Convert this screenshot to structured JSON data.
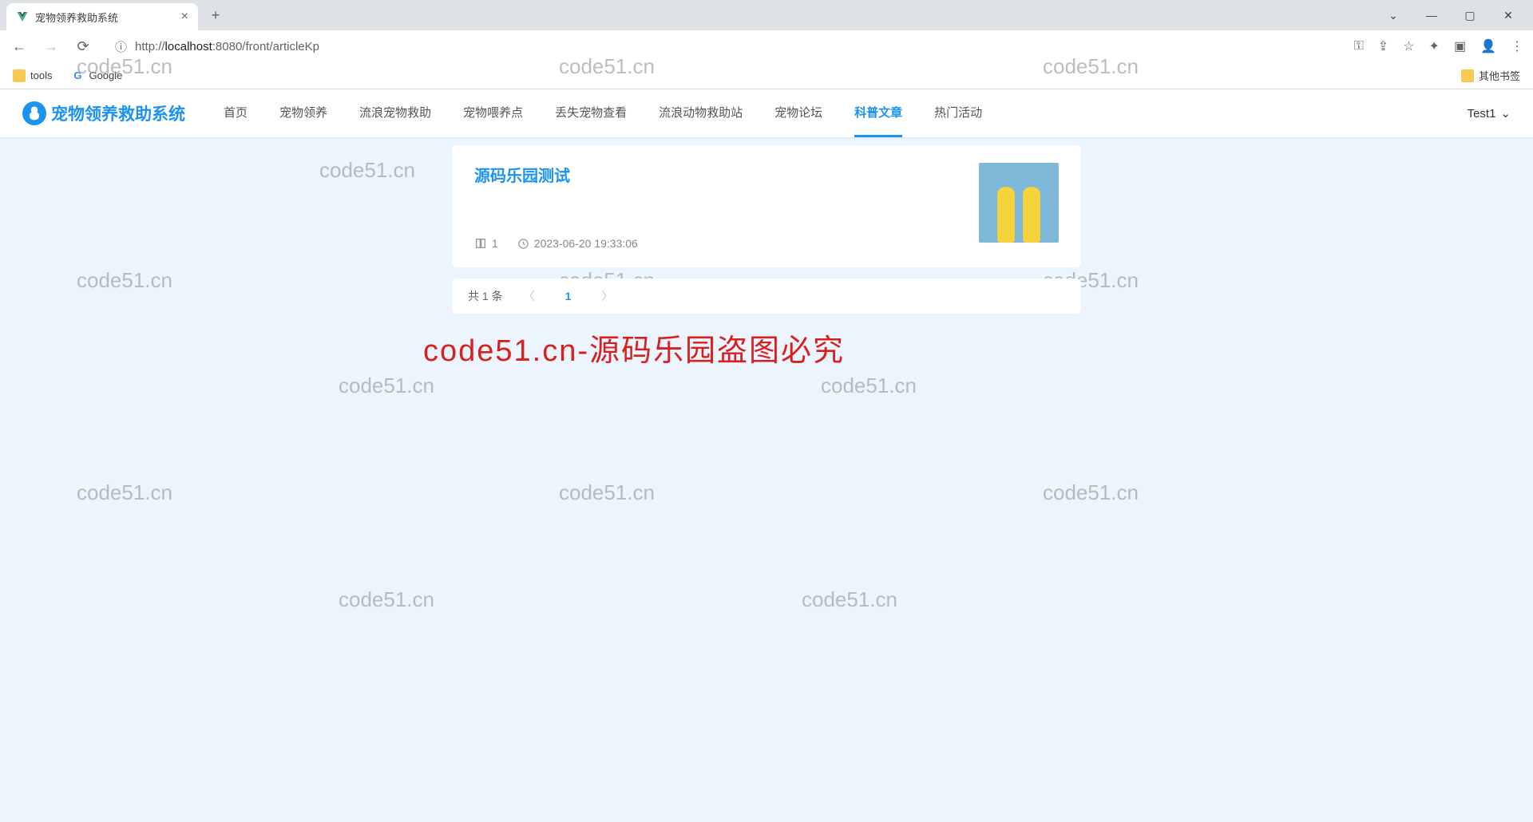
{
  "browser": {
    "tab_title": "宠物领养救助系统",
    "url_prefix": "http://",
    "url_host": "localhost",
    "url_path": ":8080/front/articleKp",
    "bookmarks": {
      "tools": "tools",
      "google": "Google",
      "other": "其他书签"
    }
  },
  "site": {
    "logo_text": "宠物领养救助系统",
    "nav": {
      "home": "首页",
      "adopt": "宠物领养",
      "stray_rescue": "流浪宠物救助",
      "feed_points": "宠物喂养点",
      "lost_pets": "丢失宠物查看",
      "stray_stations": "流浪动物救助站",
      "forum": "宠物论坛",
      "science": "科普文章",
      "activities": "热门活动"
    },
    "user": "Test1"
  },
  "article": {
    "title": "源码乐园测试",
    "views": "1",
    "timestamp": "2023-06-20 19:33:06"
  },
  "pagination": {
    "total_text": "共 1 条",
    "current": "1"
  },
  "watermark_text": "code51.cn",
  "big_watermark": "code51.cn-源码乐园盗图必究"
}
